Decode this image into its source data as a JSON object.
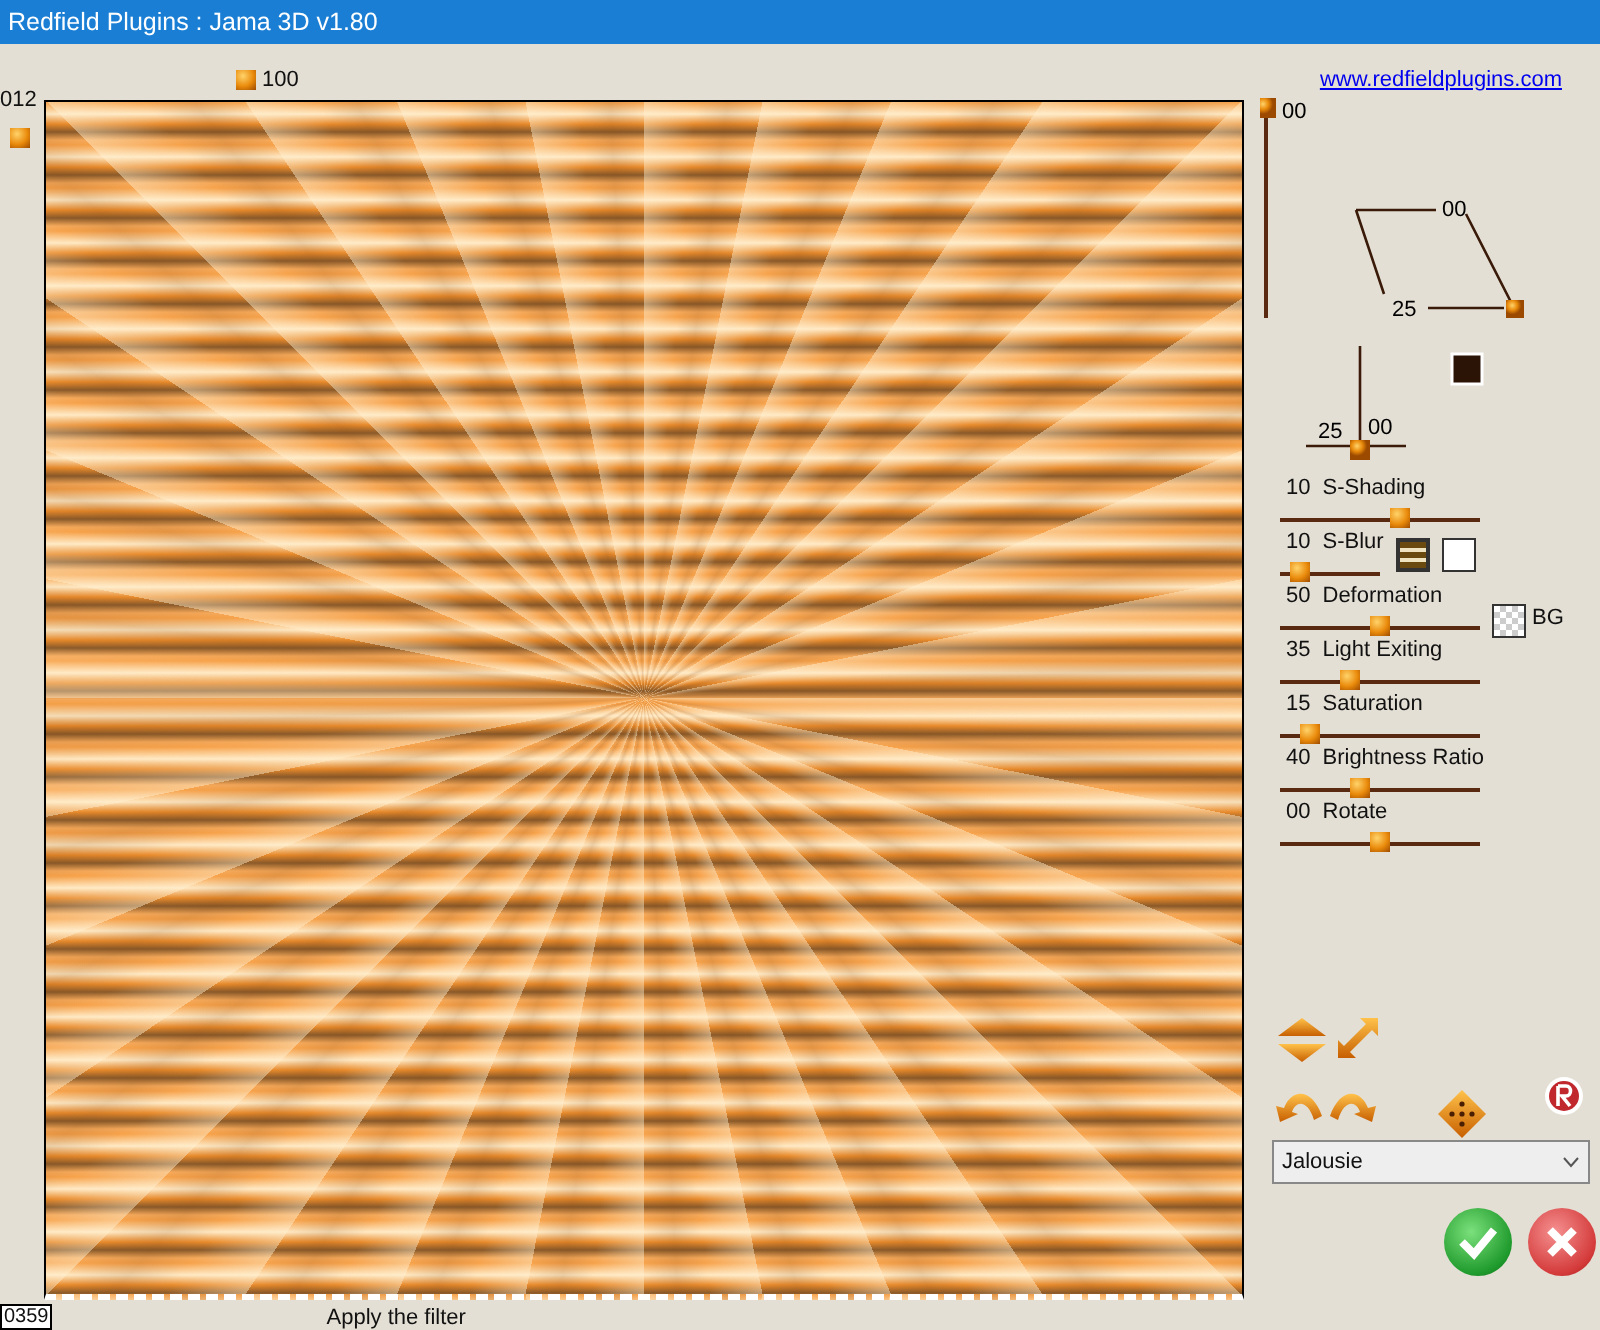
{
  "window": {
    "title": "Redfield Plugins : Jama 3D  v1.80"
  },
  "preview": {
    "top_slider": {
      "value": "100",
      "level": 0.16
    },
    "left_slider": {
      "value": "012",
      "level": 0.02
    },
    "counter": "0359",
    "hint": "Apply the filter"
  },
  "link": "www.redfieldplugins.com",
  "vertical_slider": {
    "value": "00",
    "level": 1
  },
  "parallelogram": {
    "top_label": "00",
    "bottom_label": "25"
  },
  "cross": {
    "left_label": "25",
    "right_label": "00"
  },
  "color_swatch": {
    "color": "#2b1406"
  },
  "sliders": [
    {
      "value": "10",
      "name": "S-Shading",
      "level": 0.6
    },
    {
      "value": "10",
      "name": "S-Blur",
      "level": 0.2,
      "swatches": [
        {
          "kind": "stripes"
        },
        {
          "kind": "plain",
          "color": "#ffffff"
        }
      ]
    },
    {
      "value": "50",
      "name": "Deformation",
      "level": 0.5,
      "swatches": [
        {
          "kind": "checker",
          "label": "BG"
        }
      ]
    },
    {
      "value": "35",
      "name": "Light Exiting",
      "level": 0.35
    },
    {
      "value": "15",
      "name": "Saturation",
      "level": 0.15
    },
    {
      "value": "40",
      "name": "Brightness Ratio",
      "level": 0.4
    },
    {
      "value": "00",
      "name": "Rotate",
      "level": 0.5
    }
  ],
  "dropdown": {
    "value": "Jalousie"
  }
}
